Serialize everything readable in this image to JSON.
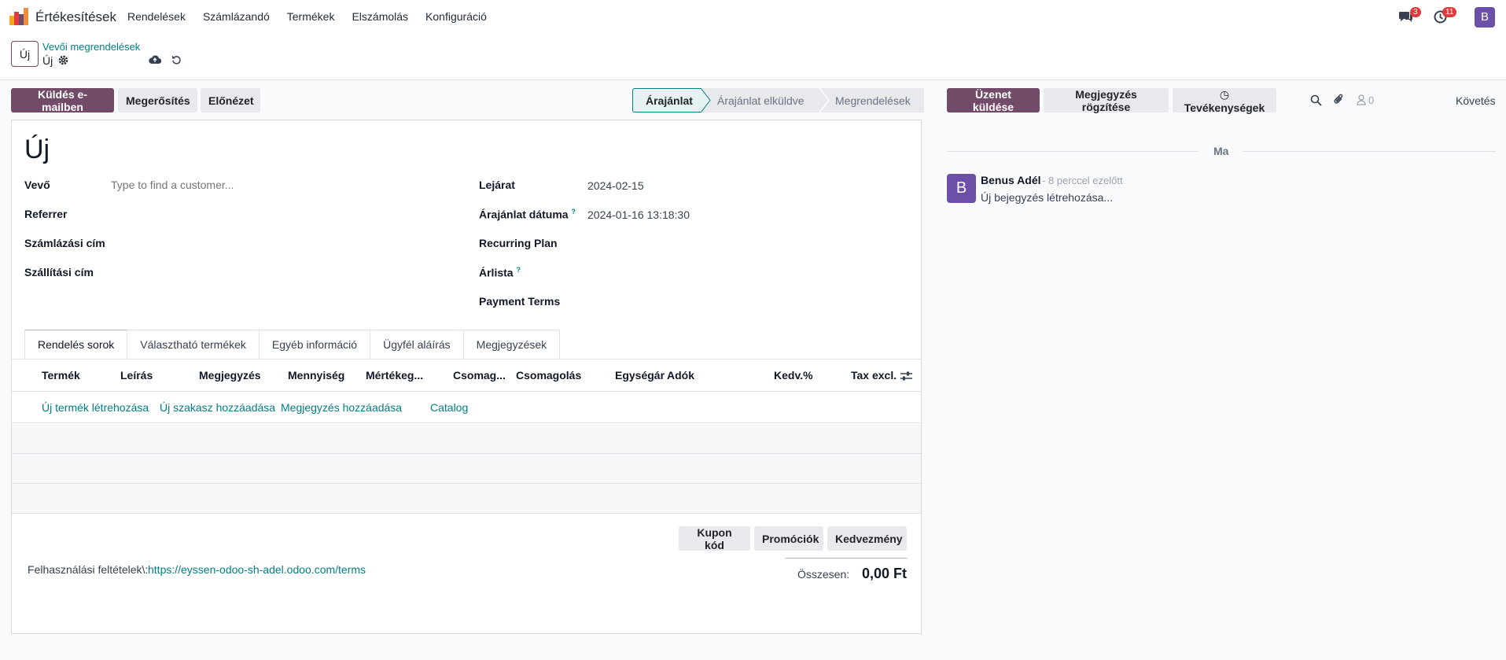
{
  "navbar": {
    "app_name": "Értékesítések",
    "menu": [
      "Rendelések",
      "Számlázandó",
      "Termékek",
      "Elszámolás",
      "Konfiguráció"
    ],
    "messages_count": "3",
    "activities_count": "11",
    "user_initial": "B"
  },
  "control": {
    "new_label": "Új",
    "breadcrumb_parent": "Vevői megrendelések",
    "breadcrumb_current": "Új"
  },
  "actions": {
    "send_email": "Küldés e-mailben",
    "confirm": "Megerősítés",
    "preview": "Előnézet"
  },
  "status": {
    "stages": [
      "Árajánlat",
      "Árajánlat elküldve",
      "Megrendelések"
    ],
    "active": "Árajánlat"
  },
  "form": {
    "title": "Új",
    "customer_label": "Vevő",
    "customer_placeholder": "Type to find a customer...",
    "referrer_label": "Referrer",
    "invoice_address_label": "Számlázási cím",
    "delivery_address_label": "Szállítási cím",
    "expiration_label": "Lejárat",
    "expiration_value": "2024-02-15",
    "quotation_date_label": "Árajánlat dátuma",
    "quotation_date_value": "2024-01-16 13:18:30",
    "recurring_plan_label": "Recurring Plan",
    "pricelist_label": "Árlista",
    "payment_terms_label": "Payment Terms",
    "help_mark": "?"
  },
  "tabs": [
    "Rendelés sorok",
    "Választható termékek",
    "Egyéb információ",
    "Ügyfél aláírás",
    "Megjegyzések"
  ],
  "table": {
    "columns": [
      "Termék",
      "Leírás",
      "Megjegyzés",
      "Mennyiség",
      "Mértékeg...",
      "Csomag...",
      "Csomagolás",
      "Egységár",
      "Adók",
      "Kedv.%",
      "Tax excl."
    ],
    "add_links": [
      "Új termék létrehozása",
      "Új szakasz hozzáadása",
      "Megjegyzés hozzáadása",
      "Catalog"
    ]
  },
  "footer": {
    "coupon": "Kupon kód",
    "promotions": "Promóciók",
    "discount": "Kedvezmény",
    "terms_label": "Felhasználási feltételek\\:",
    "terms_link": "https://eyssen-odoo-sh-adel.odoo.com/terms",
    "total_label": "Összesen:",
    "total_value": "0,00 Ft"
  },
  "chatter": {
    "send_message": "Üzenet küldése",
    "log_note": "Megjegyzés rögzítése",
    "activities": "Tevékenységek",
    "followers_count": "0",
    "follow": "Követés",
    "date_separator": "Ma",
    "message": {
      "author_initial": "B",
      "author": "Benus Adél",
      "time": "- 8 perccel ezelőtt",
      "body": "Új bejegyzés létrehozása..."
    }
  },
  "colors": {
    "primary": "#714b67",
    "link": "#017e84",
    "avatar": "#6c4fa6",
    "badge": "#e0393e"
  }
}
